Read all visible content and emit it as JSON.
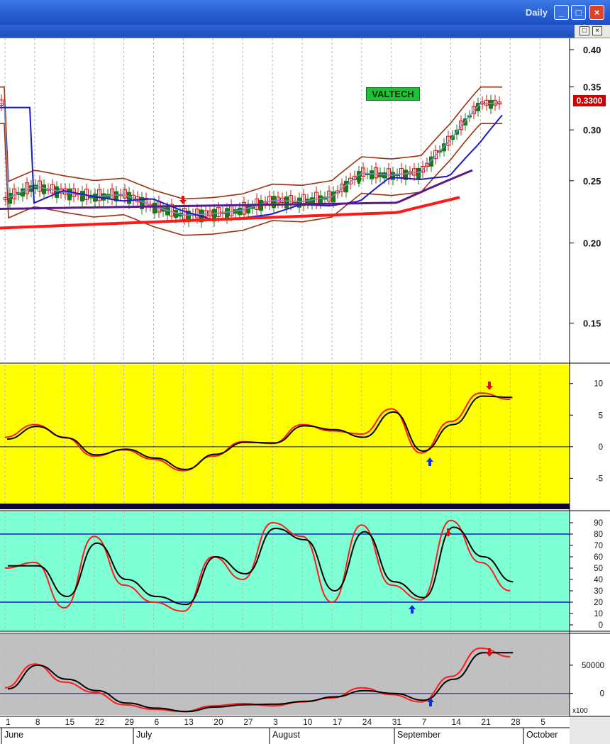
{
  "window": {
    "title": "Daily",
    "buttons": {
      "minimize": "_",
      "maximize": "□",
      "close": "×"
    }
  },
  "subwindow": {
    "restore": "□",
    "close": "×"
  },
  "ticker": "VALTECH",
  "last_price": "0.3300",
  "price_axis": [
    "0.40",
    "0.35",
    "0.30",
    "0.25",
    "0.20",
    "0.15"
  ],
  "osc1_axis": [
    "10",
    "5",
    "0",
    "-5"
  ],
  "osc2_axis": [
    "90",
    "80",
    "70",
    "60",
    "50",
    "40",
    "30",
    "20",
    "10",
    "0"
  ],
  "osc3_axis": [
    "50000",
    "0"
  ],
  "osc3_multiplier": "x100",
  "date_ticks": [
    "1",
    "8",
    "15",
    "22",
    "29",
    "6",
    "13",
    "20",
    "27",
    "3",
    "10",
    "17",
    "24",
    "31",
    "7",
    "14",
    "21",
    "28",
    "5"
  ],
  "months": [
    "June",
    "July",
    "August",
    "September",
    "October"
  ],
  "colors": {
    "panel_price_bg": "#ffffff",
    "panel_osc1_bg": "#ffff00",
    "panel_osc2_bg": "#7fffd4",
    "panel_osc3_bg": "#c0c0c0",
    "up_candle": "#1a7a1a",
    "down_candle": "#e01010",
    "ma_red": "#ff1a1a",
    "ma_blue": "#1a1acc",
    "ma_purple": "#5a1a8c",
    "bollinger": "#993311",
    "signal_up": "#1030e0",
    "signal_down": "#e01010"
  },
  "chart_data": [
    {
      "type": "line",
      "name": "price",
      "ylim": [
        0.13,
        0.4
      ],
      "log_scale": true,
      "x": [
        "1",
        "8",
        "15",
        "22",
        "29",
        "6",
        "13",
        "20",
        "27",
        "3",
        "10",
        "17",
        "24",
        "31",
        "7",
        "14",
        "21",
        "28"
      ],
      "series": [
        {
          "values": [
            0.234,
            0.245,
            0.24,
            0.236,
            0.238,
            0.228,
            0.221,
            0.222,
            0.225,
            0.233,
            0.232,
            0.236,
            0.257,
            0.255,
            0.258,
            0.29,
            0.33,
            0.33
          ]
        }
      ]
    },
    {
      "type": "line",
      "name": "oscillator_1",
      "ylim": [
        -9,
        13
      ],
      "x": [
        "1",
        "8",
        "15",
        "22",
        "29",
        "6",
        "13",
        "20",
        "27",
        "3",
        "10",
        "17",
        "24",
        "31",
        "7",
        "14",
        "21",
        "28"
      ],
      "series": [
        {
          "values": [
            1.5,
            3.5,
            1.5,
            -1.5,
            -0.5,
            -2.0,
            -3.8,
            -1.5,
            0.8,
            0.5,
            3.5,
            2.5,
            2.0,
            6.0,
            -1.0,
            4.0,
            8.5,
            7.5
          ]
        },
        {
          "values": [
            1.2,
            3.2,
            1.4,
            -1.3,
            -0.4,
            -1.8,
            -3.6,
            -1.2,
            0.7,
            0.6,
            3.3,
            2.7,
            1.5,
            5.5,
            -0.7,
            3.5,
            8.0,
            7.8
          ]
        }
      ]
    },
    {
      "type": "line",
      "name": "oscillator_2",
      "ylim": [
        -5,
        100
      ],
      "x": [
        "1",
        "8",
        "15",
        "22",
        "29",
        "6",
        "13",
        "20",
        "27",
        "3",
        "10",
        "17",
        "24",
        "31",
        "7",
        "14",
        "21",
        "28"
      ],
      "series": [
        {
          "values": [
            50,
            55,
            15,
            78,
            35,
            20,
            12,
            60,
            40,
            90,
            78,
            20,
            88,
            35,
            22,
            92,
            55,
            30
          ]
        },
        {
          "values": [
            52,
            52,
            25,
            72,
            40,
            25,
            18,
            60,
            45,
            85,
            75,
            30,
            82,
            38,
            24,
            86,
            60,
            38
          ]
        }
      ]
    },
    {
      "type": "line",
      "name": "oscillator_3",
      "ylim": [
        -38000,
        105000
      ],
      "x": [
        "1",
        "8",
        "15",
        "22",
        "29",
        "6",
        "13",
        "20",
        "27",
        "3",
        "10",
        "17",
        "24",
        "31",
        "7",
        "14",
        "21",
        "28"
      ],
      "series": [
        {
          "values": [
            10000,
            52000,
            20000,
            2000,
            -20000,
            -28000,
            -32000,
            -22000,
            -18000,
            -22000,
            -15000,
            -8000,
            10000,
            -2000,
            -15000,
            30000,
            80000,
            65000
          ]
        },
        {
          "values": [
            8000,
            50000,
            25000,
            5000,
            -17000,
            -26000,
            -32000,
            -24000,
            -20000,
            -19000,
            -14000,
            -6000,
            5000,
            0,
            -12000,
            25000,
            72000,
            72000
          ]
        }
      ]
    }
  ]
}
